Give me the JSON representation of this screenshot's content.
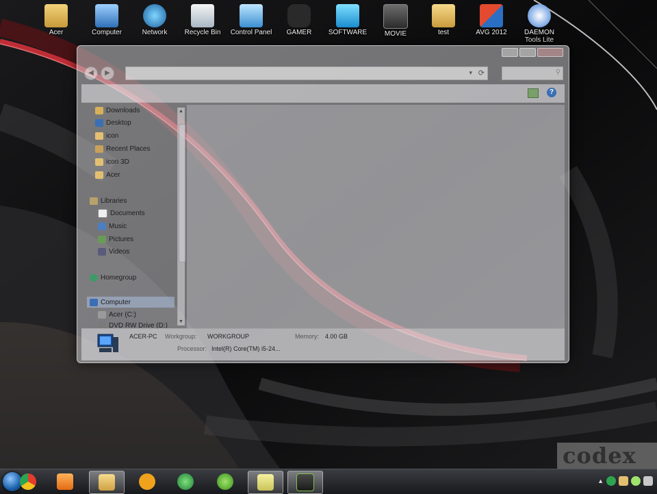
{
  "desktop": {
    "icons": [
      {
        "label": "Acer",
        "icon": "folder-user-icon"
      },
      {
        "label": "Computer",
        "icon": "computer-icon"
      },
      {
        "label": "Network",
        "icon": "network-icon"
      },
      {
        "label": "Recycle Bin",
        "icon": "recycle-bin-icon"
      },
      {
        "label": "Control Panel",
        "icon": "control-panel-icon"
      },
      {
        "label": "GAMER",
        "icon": "gamepad-icon"
      },
      {
        "label": "SOFTWARE",
        "icon": "software-icon"
      },
      {
        "label": "MOVIE",
        "icon": "movie-icon"
      },
      {
        "label": "test",
        "icon": "folder-icon"
      },
      {
        "label": "AVG 2012",
        "icon": "avg-icon"
      },
      {
        "label": "DAEMON Tools Lite",
        "icon": "daemon-tools-icon"
      }
    ]
  },
  "explorer": {
    "search_placeholder": "",
    "nav_items": [
      {
        "label": "Downloads",
        "icon": "downloads-folder-icon"
      },
      {
        "label": "Desktop",
        "icon": "desktop-icon"
      },
      {
        "label": "icon",
        "icon": "folder-icon"
      },
      {
        "label": "Recent Places",
        "icon": "recent-places-icon"
      },
      {
        "label": "icon 3D",
        "icon": "folder-icon"
      },
      {
        "label": "Acer",
        "icon": "folder-icon"
      },
      {
        "label": "Libraries",
        "icon": "libraries-icon"
      },
      {
        "label": "Documents",
        "icon": "documents-icon"
      },
      {
        "label": "Music",
        "icon": "music-icon"
      },
      {
        "label": "Pictures",
        "icon": "pictures-icon"
      },
      {
        "label": "Videos",
        "icon": "videos-icon"
      },
      {
        "label": "Homegroup",
        "icon": "homegroup-icon"
      },
      {
        "label": "Computer",
        "icon": "computer-icon"
      },
      {
        "label": "Acer (C:)",
        "icon": "drive-icon"
      },
      {
        "label": "DVD RW Drive (D:)",
        "icon": "dvd-drive-icon"
      }
    ],
    "details": {
      "computer_name": "ACER-PC",
      "workgroup_label": "Workgroup:",
      "workgroup_value": "WORKGROUP",
      "memory_label": "Memory:",
      "memory_value": "4.00 GB",
      "processor_label": "Processor:",
      "processor_value": "Intel(R) Core(TM) i5-24..."
    }
  },
  "taskbar": {
    "buttons": [
      {
        "name": "chrome",
        "icon": "chrome-icon",
        "active": false
      },
      {
        "name": "media-player",
        "icon": "media-player-icon",
        "active": false
      },
      {
        "name": "explorer",
        "icon": "folder-icon",
        "active": true
      },
      {
        "name": "app-orange",
        "icon": "app-icon",
        "active": false
      },
      {
        "name": "download-manager",
        "icon": "download-manager-icon",
        "active": false
      },
      {
        "name": "utorrent",
        "icon": "utorrent-icon",
        "active": false
      },
      {
        "name": "sticky-notes",
        "icon": "sticky-notes-icon",
        "active": true
      },
      {
        "name": "app-window",
        "icon": "window-icon",
        "active": true
      }
    ]
  },
  "watermark": "codex",
  "colors": {
    "wallpaper_red": "#d2303a",
    "taskbar_bg": "#1f2125"
  }
}
